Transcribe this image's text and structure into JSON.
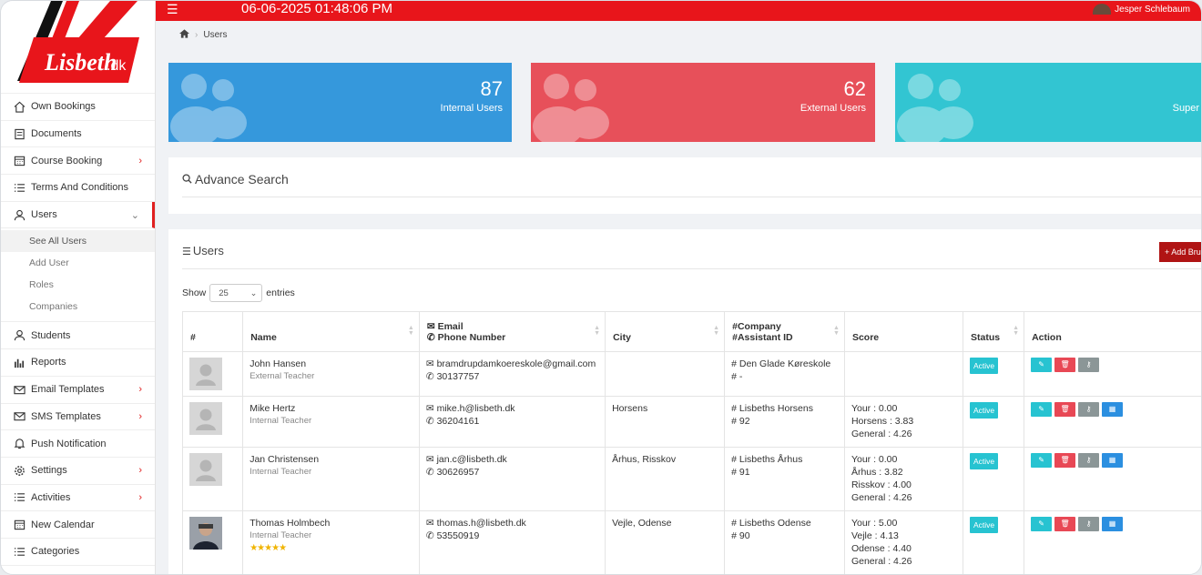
{
  "topbar": {
    "datetime": "06-06-2025 01:48:06 PM",
    "user_name": "Jesper Schlebaum"
  },
  "logo": {
    "text": "Lisbeth.dk"
  },
  "sidebar": {
    "items": [
      {
        "label": "Own Bookings",
        "icon": "home-icon"
      },
      {
        "label": "Documents",
        "icon": "document-icon"
      },
      {
        "label": "Course Booking",
        "icon": "calendar-icon",
        "chevron": true
      },
      {
        "label": "Terms And Conditions",
        "icon": "list-icon"
      },
      {
        "label": "Users",
        "icon": "users-icon",
        "expanded": true
      },
      {
        "label": "Students",
        "icon": "users-icon"
      },
      {
        "label": "Reports",
        "icon": "chart-icon"
      },
      {
        "label": "Email Templates",
        "icon": "mail-icon",
        "chevron": true
      },
      {
        "label": "SMS Templates",
        "icon": "mail-icon",
        "chevron": true
      },
      {
        "label": "Push Notification",
        "icon": "bell-icon"
      },
      {
        "label": "Settings",
        "icon": "gear-icon",
        "chevron": true
      },
      {
        "label": "Activities",
        "icon": "list-icon",
        "chevron": true
      },
      {
        "label": "New Calendar",
        "icon": "calendar-icon"
      },
      {
        "label": "Categories",
        "icon": "list-icon"
      }
    ],
    "users_sub": [
      "See All Users",
      "Add User",
      "Roles",
      "Companies"
    ]
  },
  "breadcrumb": {
    "current": "Users"
  },
  "stats": [
    {
      "value": "87",
      "label": "Internal Users",
      "color": "#3598dc"
    },
    {
      "value": "62",
      "label": "External Users",
      "color": "#e7505a"
    },
    {
      "value": "",
      "label": "Super",
      "color": "#32c5d2"
    }
  ],
  "advance_search": {
    "title": "Advance Search"
  },
  "users_panel": {
    "title": "Users",
    "add_button": "+ Add Bru",
    "show_label": "Show",
    "entries_value": "25",
    "entries_label": "entries"
  },
  "table": {
    "headers": {
      "num": "#",
      "name": "Name",
      "email": "Email",
      "phone": "Phone Number",
      "city": "City",
      "company": "#Company",
      "assistant": "#Assistant ID",
      "score": "Score",
      "status": "Status",
      "action": "Action"
    },
    "rows": [
      {
        "name": "John Hansen",
        "role": "External Teacher",
        "email": "bramdrupdamkoereskole@gmail.com",
        "phone": "30137757",
        "city": "",
        "company": "# Den Glade Køreskole",
        "assistant": "# -",
        "score": [],
        "status": "Active",
        "actions": 3,
        "photo": false,
        "stars": ""
      },
      {
        "name": "Mike Hertz",
        "role": "Internal Teacher",
        "email": "mike.h@lisbeth.dk",
        "phone": "36204161",
        "city": "Horsens",
        "company": "# Lisbeths Horsens",
        "assistant": "# 92",
        "score": [
          "Your : 0.00",
          "Horsens : 3.83",
          "General : 4.26"
        ],
        "status": "Active",
        "actions": 4,
        "photo": false,
        "stars": ""
      },
      {
        "name": "Jan Christensen",
        "role": "Internal Teacher",
        "email": "jan.c@lisbeth.dk",
        "phone": "30626957",
        "city": "Århus, Risskov",
        "company": "# Lisbeths Århus",
        "assistant": "# 91",
        "score": [
          "Your : 0.00",
          "Århus : 3.82",
          "Risskov : 4.00",
          "General : 4.26"
        ],
        "status": "Active",
        "actions": 4,
        "photo": false,
        "stars": ""
      },
      {
        "name": "Thomas Holmbech",
        "role": "Internal Teacher",
        "email": "thomas.h@lisbeth.dk",
        "phone": "53550919",
        "city": "Vejle, Odense",
        "company": "# Lisbeths Odense",
        "assistant": "# 90",
        "score": [
          "Your : 5.00",
          "Vejle : 4.13",
          "Odense : 4.40",
          "General : 4.26"
        ],
        "status": "Active",
        "actions": 4,
        "photo": true,
        "stars": "★★★★★"
      }
    ]
  }
}
